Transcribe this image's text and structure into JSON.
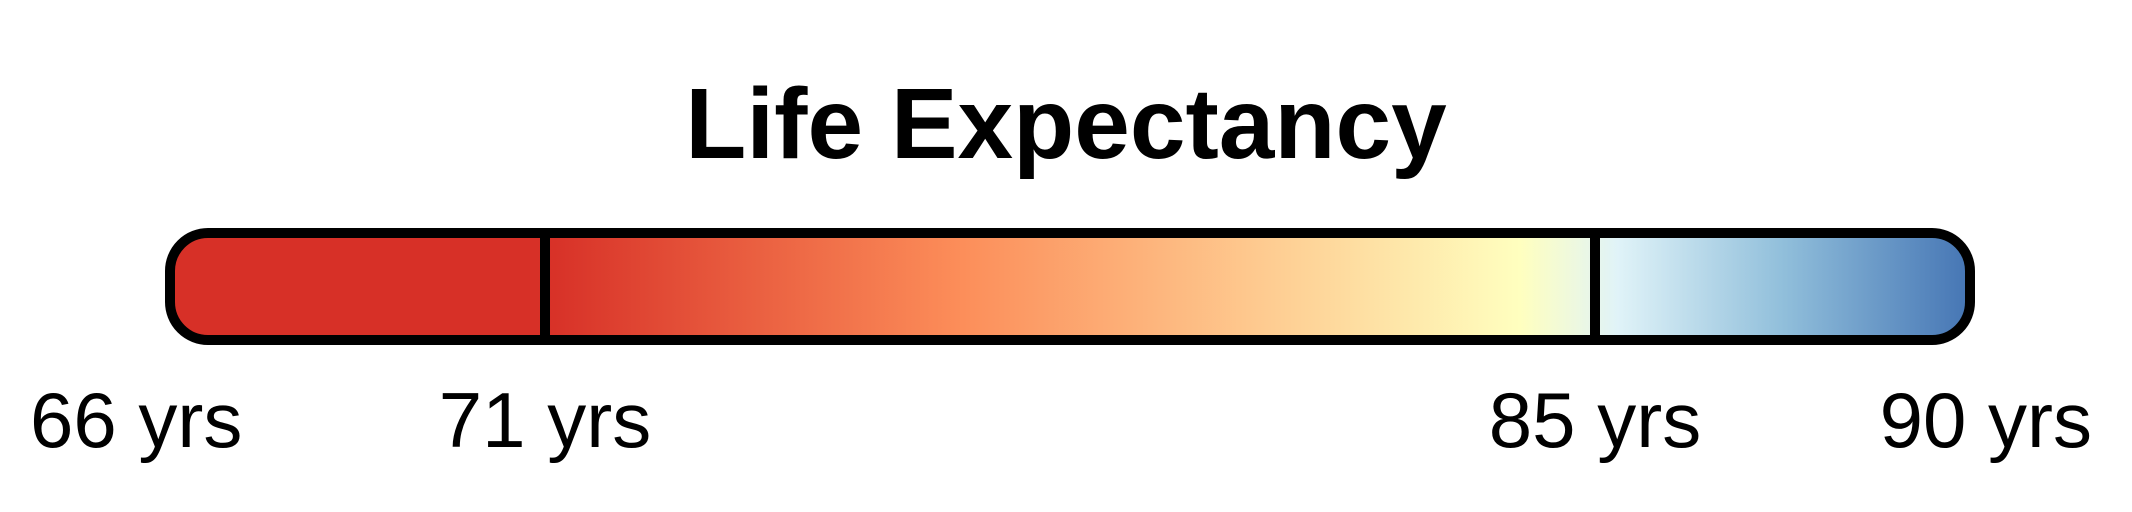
{
  "chart_data": {
    "type": "color-legend",
    "title": "Life Expectancy",
    "unit": "yrs",
    "domain": [
      66,
      90
    ],
    "ticks": [
      {
        "value": 66,
        "label": "66 yrs"
      },
      {
        "value": 71,
        "label": "71 yrs"
      },
      {
        "value": 85,
        "label": "85 yrs"
      },
      {
        "value": 90,
        "label": "90 yrs"
      }
    ],
    "color_stops": [
      {
        "value": 66,
        "color": "#d73027"
      },
      {
        "value": 71,
        "color": "#d73027"
      },
      {
        "value": 76.5,
        "color": "#fc8d59"
      },
      {
        "value": 84,
        "color": "#ffffbf"
      },
      {
        "value": 85.3,
        "color": "#e0f3f8"
      },
      {
        "value": 87.5,
        "color": "#91bfdb"
      },
      {
        "value": 90,
        "color": "#4575b4"
      }
    ],
    "dividers": [
      71,
      85
    ]
  }
}
